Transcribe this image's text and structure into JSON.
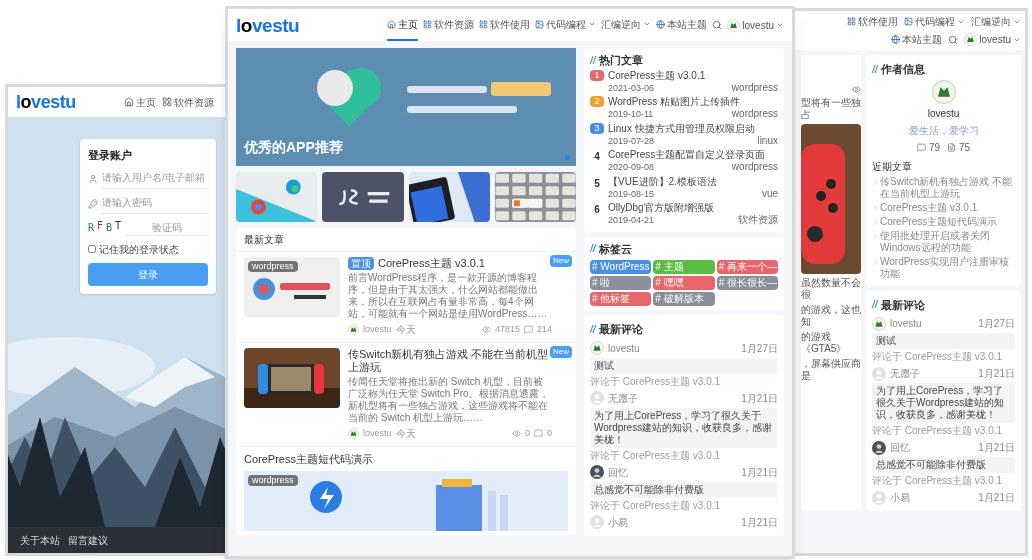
{
  "left_window": {
    "logo": "lovestu",
    "nav": [
      {
        "label": "主页",
        "selected": false
      },
      {
        "label": "软件资源",
        "selected": false
      }
    ],
    "login": {
      "title": "登录账户",
      "username_placeholder": "请输入用户名/电子邮箱",
      "password_placeholder": "请输入密码",
      "captcha": [
        {
          "char": "R",
          "color": "#2f7a3a"
        },
        {
          "char": "F",
          "color": "#7a2f7a"
        },
        {
          "char": "B",
          "color": "#2f7a3a"
        },
        {
          "char": "T",
          "color": "#333333"
        }
      ],
      "captcha_placeholder": "验证码",
      "remember": {
        "label": "记住我的登录状态",
        "checked": false
      },
      "submit": "登录"
    },
    "footer_links": [
      "关于本站",
      "留言建议"
    ]
  },
  "center_window": {
    "logo": "lovestu",
    "nav": [
      {
        "label": "主页",
        "selected": true,
        "dropdown": false
      },
      {
        "label": "软件资源",
        "selected": false,
        "dropdown": false
      },
      {
        "label": "软件使用",
        "selected": false,
        "dropdown": false
      },
      {
        "label": "代码编程",
        "selected": false,
        "dropdown": true
      },
      {
        "label": "汇编逆向",
        "selected": false,
        "dropdown": true
      },
      {
        "label": "本站主题",
        "selected": false,
        "dropdown": false
      }
    ],
    "user": "lovestu",
    "banner": {
      "caption": "优秀的APP推荐"
    },
    "latest": {
      "heading": "最新文章",
      "posts": [
        {
          "kind": "list",
          "thumb_label": "wordpress",
          "tag": "置顶",
          "title": "CorePress主题 v3.0.1",
          "badge": "New",
          "excerpt": "前言WordPress程序，是一款开源的博客程序，但是由于其太强大，什么网站都能做出来，所以在互联网占有量非常高，每4个网站，可能就有一个网站是使用WordPress……",
          "author": "lovestu",
          "time": "今天",
          "views": "47815",
          "comments": "214"
        },
        {
          "kind": "list",
          "title": "传Switch新机有独占游戏 不能在当前机型上游玩",
          "badge": "New",
          "excerpt": "传闻任天堂将推出新的 Switch 机型，目前被广泛称为任天堂 Switch Pro。根据消息透露，新机型将有一些独占游戏，这些游戏将不能在当前的 Switch 机型上游玩……",
          "author": "lovestu",
          "time": "今天",
          "views": "0",
          "comments": "0"
        },
        {
          "kind": "feature",
          "title": "CorePress主题短代码演示",
          "thumb_label": "wordpress"
        }
      ]
    },
    "hot": {
      "mark": "//",
      "heading": "热门文章",
      "items": [
        {
          "rank": "1",
          "color": "#e8676b",
          "title": "CorePress主题 v3.0.1",
          "date": "2021-03-06",
          "category": "wordpress"
        },
        {
          "rank": "2",
          "color": "#f0a030",
          "title": "WordPress 粘贴图片上传插件",
          "date": "2019-10-11",
          "category": "wordpress"
        },
        {
          "rank": "3",
          "color": "#4a90e2",
          "title": "Linux 快捷方式用管理员权限启动",
          "date": "2019-07-28",
          "category": "linux"
        },
        {
          "rank": "4",
          "title": "CorePress主题配置自定义登录页面",
          "date": "2020-09-08",
          "category": "wordpress"
        },
        {
          "rank": "5",
          "title": "【VUE进阶】2.模板语法",
          "date": "2019-08-15",
          "category": "vue"
        },
        {
          "rank": "6",
          "title": "OllyDbg官方版附增强版",
          "date": "2019-04-21",
          "category": "软件资源"
        }
      ]
    },
    "tags": {
      "mark": "//",
      "heading": "标签云",
      "items": [
        {
          "label": "# WordPress",
          "color": "#4a90e2"
        },
        {
          "label": "# 主题",
          "color": "#5bbd45"
        },
        {
          "label": "# 再来一个—",
          "color": "#e8666b"
        },
        {
          "label": "# 啦",
          "color": "#8a8f99"
        },
        {
          "label": "# 嘿嘿",
          "color": "#e8666b"
        },
        {
          "label": "# 很长很长—",
          "color": "#8a8f99"
        },
        {
          "label": "# 他标签",
          "color": "#e8666b"
        },
        {
          "label": "# 破解版本",
          "color": "#8a8f99"
        }
      ]
    },
    "comments": {
      "mark": "//",
      "heading": "最新评论",
      "items": [
        {
          "kind": "logo",
          "author": "lovestu",
          "date": "1月27日",
          "body": "测试",
          "ref": "评论于 CorePress主题 v3.0.1"
        },
        {
          "kind": "blank",
          "author": "无愿子",
          "date": "1月21日",
          "body": "为了用上CorePress，学习了很久关于Wordpress建站的知识，收获良多，感谢美栊！",
          "ref": "评论于 CorePress主题 v3.0.1"
        },
        {
          "kind": "dark",
          "author": "回忆",
          "date": "1月21日",
          "body": "总感觉不可能除非付费版",
          "ref": "评论于 CorePress主题 v3.0.1"
        },
        {
          "kind": "blank",
          "author": "小易",
          "date": "1月21日"
        }
      ]
    }
  },
  "right_window": {
    "nav": [
      {
        "label": "软件使用",
        "dropdown": false
      },
      {
        "label": "代码编程",
        "dropdown": true
      },
      {
        "label": "汇编逆向",
        "dropdown": true
      },
      {
        "label": "本站主题",
        "dropdown": false
      }
    ],
    "user": "lovestu",
    "excerpt_top": "型将有一些独占",
    "excerpt_bottom": [
      "虽然数量不会很",
      "的游戏，这也知",
      "的游戏《GTA5》",
      "，屏幕供应商是"
    ],
    "author": {
      "mark": "//",
      "heading": "作者信息",
      "name": "lovestu",
      "motto": "爱生活，爱学习",
      "comment_count": "79",
      "post_count": "75",
      "recent_heading": "近期文章",
      "recent": [
        "传Switch新机有独占游戏 不能在当前机型上游玩",
        "CorePress主题 v3.0.1",
        "CorePress主题短代码演示",
        "使用批处理开启或者关闭Windows远程的功能",
        "WordPress实现用户注册审核功能"
      ]
    },
    "comments": {
      "mark": "//",
      "heading": "最新评论",
      "items": [
        {
          "kind": "logo",
          "author": "lovestu",
          "date": "1月27日",
          "body": "测试",
          "ref": "评论于 CorePress主题 v3.0.1"
        },
        {
          "kind": "blank",
          "author": "无愿子",
          "date": "1月21日",
          "body": "为了用上CorePress，学习了很久关于Wordpress建站的知识，收获良多，感谢美栊！",
          "ref": "评论于 CorePress主题 v3.0.1"
        },
        {
          "kind": "dark",
          "author": "回忆",
          "date": "1月21日",
          "body": "总感觉不可能除非付费版",
          "ref": "评论于 CorePress主题 v3.0.1"
        },
        {
          "kind": "blank",
          "author": "小易",
          "date": "1月21日"
        }
      ]
    }
  }
}
